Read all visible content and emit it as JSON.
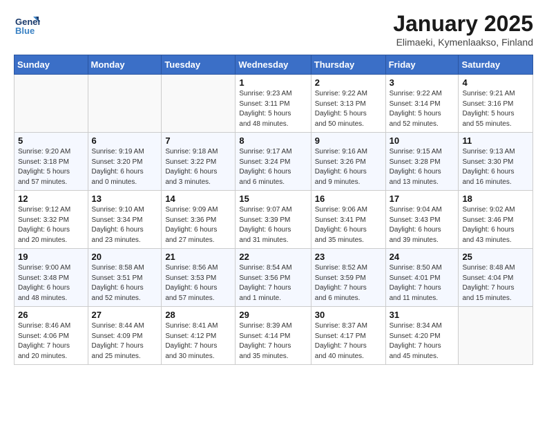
{
  "logo": {
    "line1": "General",
    "line2": "Blue"
  },
  "title": "January 2025",
  "subtitle": "Elimaeki, Kymenlaakso, Finland",
  "weekdays": [
    "Sunday",
    "Monday",
    "Tuesday",
    "Wednesday",
    "Thursday",
    "Friday",
    "Saturday"
  ],
  "weeks": [
    [
      {
        "day": "",
        "info": ""
      },
      {
        "day": "",
        "info": ""
      },
      {
        "day": "",
        "info": ""
      },
      {
        "day": "1",
        "info": "Sunrise: 9:23 AM\nSunset: 3:11 PM\nDaylight: 5 hours\nand 48 minutes."
      },
      {
        "day": "2",
        "info": "Sunrise: 9:22 AM\nSunset: 3:13 PM\nDaylight: 5 hours\nand 50 minutes."
      },
      {
        "day": "3",
        "info": "Sunrise: 9:22 AM\nSunset: 3:14 PM\nDaylight: 5 hours\nand 52 minutes."
      },
      {
        "day": "4",
        "info": "Sunrise: 9:21 AM\nSunset: 3:16 PM\nDaylight: 5 hours\nand 55 minutes."
      }
    ],
    [
      {
        "day": "5",
        "info": "Sunrise: 9:20 AM\nSunset: 3:18 PM\nDaylight: 5 hours\nand 57 minutes."
      },
      {
        "day": "6",
        "info": "Sunrise: 9:19 AM\nSunset: 3:20 PM\nDaylight: 6 hours\nand 0 minutes."
      },
      {
        "day": "7",
        "info": "Sunrise: 9:18 AM\nSunset: 3:22 PM\nDaylight: 6 hours\nand 3 minutes."
      },
      {
        "day": "8",
        "info": "Sunrise: 9:17 AM\nSunset: 3:24 PM\nDaylight: 6 hours\nand 6 minutes."
      },
      {
        "day": "9",
        "info": "Sunrise: 9:16 AM\nSunset: 3:26 PM\nDaylight: 6 hours\nand 9 minutes."
      },
      {
        "day": "10",
        "info": "Sunrise: 9:15 AM\nSunset: 3:28 PM\nDaylight: 6 hours\nand 13 minutes."
      },
      {
        "day": "11",
        "info": "Sunrise: 9:13 AM\nSunset: 3:30 PM\nDaylight: 6 hours\nand 16 minutes."
      }
    ],
    [
      {
        "day": "12",
        "info": "Sunrise: 9:12 AM\nSunset: 3:32 PM\nDaylight: 6 hours\nand 20 minutes."
      },
      {
        "day": "13",
        "info": "Sunrise: 9:10 AM\nSunset: 3:34 PM\nDaylight: 6 hours\nand 23 minutes."
      },
      {
        "day": "14",
        "info": "Sunrise: 9:09 AM\nSunset: 3:36 PM\nDaylight: 6 hours\nand 27 minutes."
      },
      {
        "day": "15",
        "info": "Sunrise: 9:07 AM\nSunset: 3:39 PM\nDaylight: 6 hours\nand 31 minutes."
      },
      {
        "day": "16",
        "info": "Sunrise: 9:06 AM\nSunset: 3:41 PM\nDaylight: 6 hours\nand 35 minutes."
      },
      {
        "day": "17",
        "info": "Sunrise: 9:04 AM\nSunset: 3:43 PM\nDaylight: 6 hours\nand 39 minutes."
      },
      {
        "day": "18",
        "info": "Sunrise: 9:02 AM\nSunset: 3:46 PM\nDaylight: 6 hours\nand 43 minutes."
      }
    ],
    [
      {
        "day": "19",
        "info": "Sunrise: 9:00 AM\nSunset: 3:48 PM\nDaylight: 6 hours\nand 48 minutes."
      },
      {
        "day": "20",
        "info": "Sunrise: 8:58 AM\nSunset: 3:51 PM\nDaylight: 6 hours\nand 52 minutes."
      },
      {
        "day": "21",
        "info": "Sunrise: 8:56 AM\nSunset: 3:53 PM\nDaylight: 6 hours\nand 57 minutes."
      },
      {
        "day": "22",
        "info": "Sunrise: 8:54 AM\nSunset: 3:56 PM\nDaylight: 7 hours\nand 1 minute."
      },
      {
        "day": "23",
        "info": "Sunrise: 8:52 AM\nSunset: 3:59 PM\nDaylight: 7 hours\nand 6 minutes."
      },
      {
        "day": "24",
        "info": "Sunrise: 8:50 AM\nSunset: 4:01 PM\nDaylight: 7 hours\nand 11 minutes."
      },
      {
        "day": "25",
        "info": "Sunrise: 8:48 AM\nSunset: 4:04 PM\nDaylight: 7 hours\nand 15 minutes."
      }
    ],
    [
      {
        "day": "26",
        "info": "Sunrise: 8:46 AM\nSunset: 4:06 PM\nDaylight: 7 hours\nand 20 minutes."
      },
      {
        "day": "27",
        "info": "Sunrise: 8:44 AM\nSunset: 4:09 PM\nDaylight: 7 hours\nand 25 minutes."
      },
      {
        "day": "28",
        "info": "Sunrise: 8:41 AM\nSunset: 4:12 PM\nDaylight: 7 hours\nand 30 minutes."
      },
      {
        "day": "29",
        "info": "Sunrise: 8:39 AM\nSunset: 4:14 PM\nDaylight: 7 hours\nand 35 minutes."
      },
      {
        "day": "30",
        "info": "Sunrise: 8:37 AM\nSunset: 4:17 PM\nDaylight: 7 hours\nand 40 minutes."
      },
      {
        "day": "31",
        "info": "Sunrise: 8:34 AM\nSunset: 4:20 PM\nDaylight: 7 hours\nand 45 minutes."
      },
      {
        "day": "",
        "info": ""
      }
    ]
  ]
}
